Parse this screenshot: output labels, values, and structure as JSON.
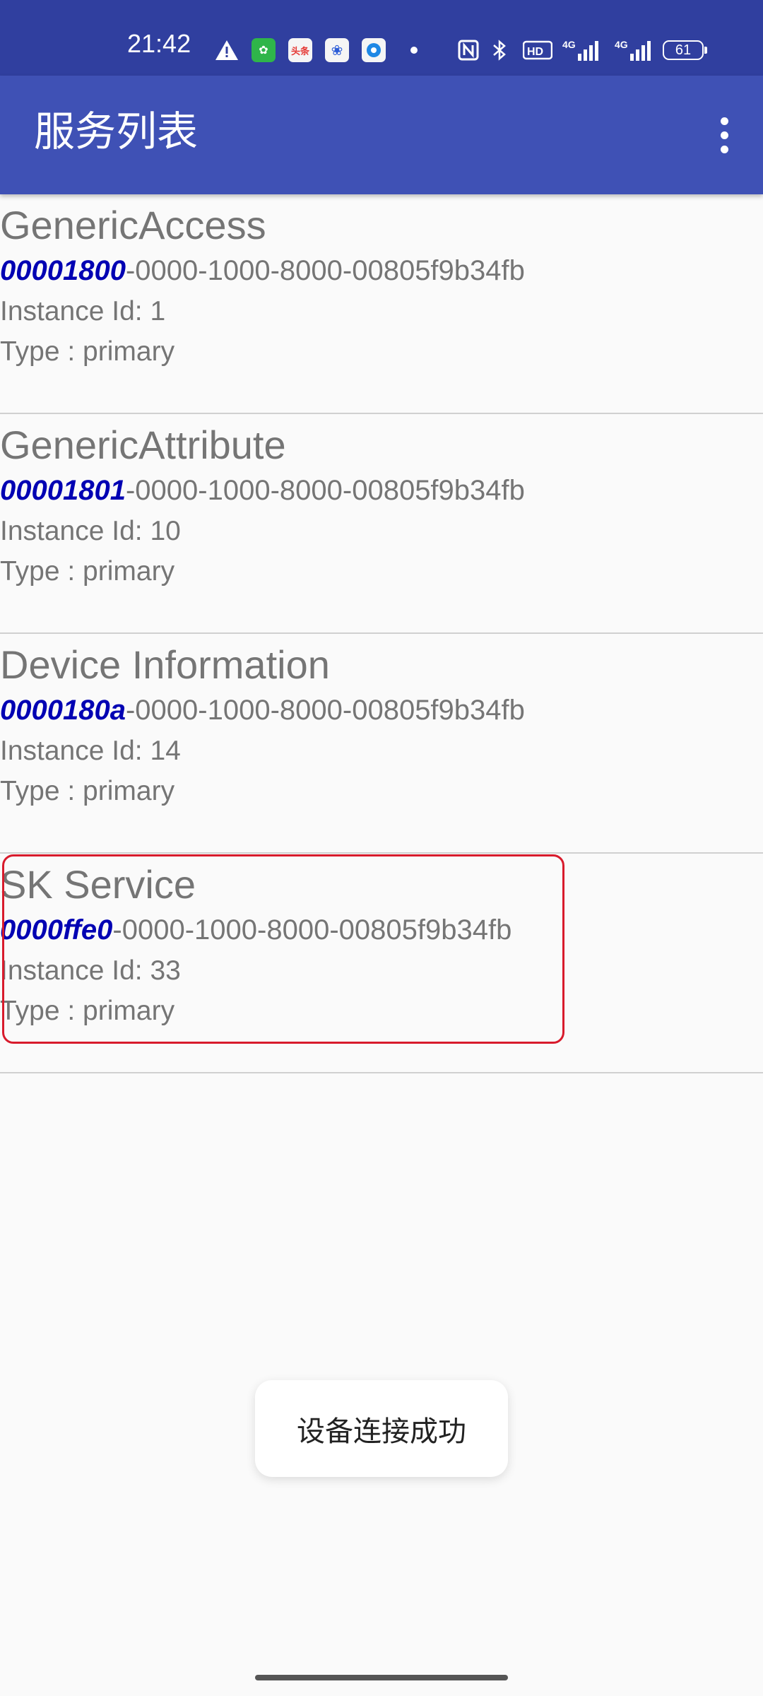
{
  "status_bar": {
    "time": "21:42",
    "notification_icons": [
      "warning-icon",
      "app-icon-green",
      "toutiao-icon",
      "baidu-icon",
      "browser-icon",
      "dot-icon"
    ],
    "toutiao_label": "头条",
    "status_icons": [
      "nfc-icon",
      "bluetooth-icon",
      "hd-icon",
      "signal-4g-icon",
      "signal-4g-icon"
    ],
    "battery_level": "61"
  },
  "app_bar": {
    "title": "服务列表",
    "menu_icon": "more-vert-icon"
  },
  "services": [
    {
      "name": "GenericAccess",
      "uuid_short": "00001800",
      "uuid_rest": "-0000-1000-8000-00805f9b34fb",
      "instance_id": "Instance Id: 1",
      "type": "Type : primary"
    },
    {
      "name": "GenericAttribute",
      "uuid_short": "00001801",
      "uuid_rest": "-0000-1000-8000-00805f9b34fb",
      "instance_id": "Instance Id: 10",
      "type": "Type : primary"
    },
    {
      "name": "Device Information",
      "uuid_short": "0000180a",
      "uuid_rest": "-0000-1000-8000-00805f9b34fb",
      "instance_id": "Instance Id: 14",
      "type": "Type : primary"
    },
    {
      "name": "SK Service",
      "uuid_short": "0000ffe0",
      "uuid_rest": "-0000-1000-8000-00805f9b34fb",
      "instance_id": "Instance Id: 33",
      "type": "Type : primary"
    }
  ],
  "toast": {
    "message": "设备连接成功"
  },
  "colors": {
    "status_bar": "#303f9f",
    "app_bar": "#3f51b5",
    "uuid_accent": "#0000b3",
    "highlight_border": "#d81b2c"
  }
}
